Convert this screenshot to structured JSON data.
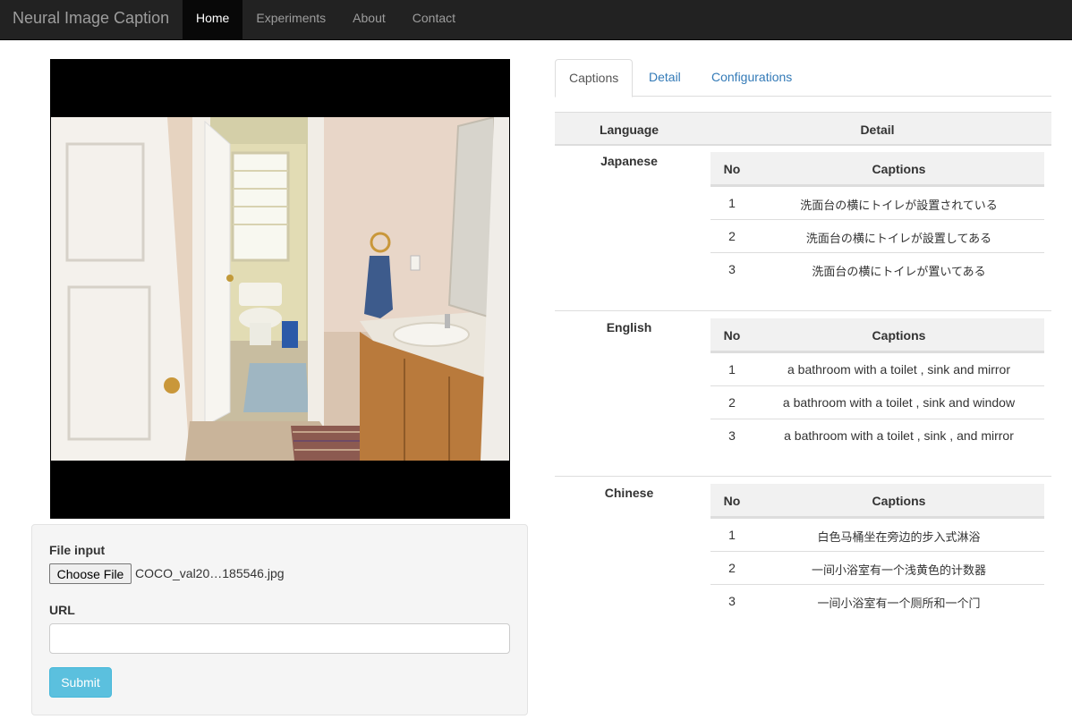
{
  "navbar": {
    "brand": "Neural Image Caption",
    "items": [
      {
        "label": "Home",
        "active": true
      },
      {
        "label": "Experiments",
        "active": false
      },
      {
        "label": "About",
        "active": false
      },
      {
        "label": "Contact",
        "active": false
      }
    ]
  },
  "form": {
    "file_label": "File input",
    "choose_file_label": "Choose File",
    "file_name": "COCO_val20…185546.jpg",
    "url_label": "URL",
    "url_value": "",
    "submit_label": "Submit"
  },
  "tabs": [
    {
      "label": "Captions",
      "active": true
    },
    {
      "label": "Detail",
      "active": false
    },
    {
      "label": "Configurations",
      "active": false
    }
  ],
  "results": {
    "header_language": "Language",
    "header_detail": "Detail",
    "inner_header_no": "No",
    "inner_header_captions": "Captions",
    "languages": [
      {
        "name": "Japanese",
        "captions": [
          {
            "no": "1",
            "text": "洗面台の横にトイレが設置されている"
          },
          {
            "no": "2",
            "text": "洗面台の横にトイレが設置してある"
          },
          {
            "no": "3",
            "text": "洗面台の横にトイレが置いてある"
          }
        ]
      },
      {
        "name": "English",
        "captions": [
          {
            "no": "1",
            "text": "a bathroom with a toilet , sink and mirror"
          },
          {
            "no": "2",
            "text": "a bathroom with a toilet , sink and window"
          },
          {
            "no": "3",
            "text": "a bathroom with a toilet , sink , and mirror"
          }
        ]
      },
      {
        "name": "Chinese",
        "captions": [
          {
            "no": "1",
            "text": "白色马桶坐在旁边的步入式淋浴"
          },
          {
            "no": "2",
            "text": "一间小浴室有一个浅黄色的计数器"
          },
          {
            "no": "3",
            "text": "一间小浴室有一个厕所和一个门"
          }
        ]
      }
    ]
  },
  "colors": {
    "navbar_bg": "#222222",
    "link": "#337ab7",
    "submit_bg": "#5bc0de"
  }
}
